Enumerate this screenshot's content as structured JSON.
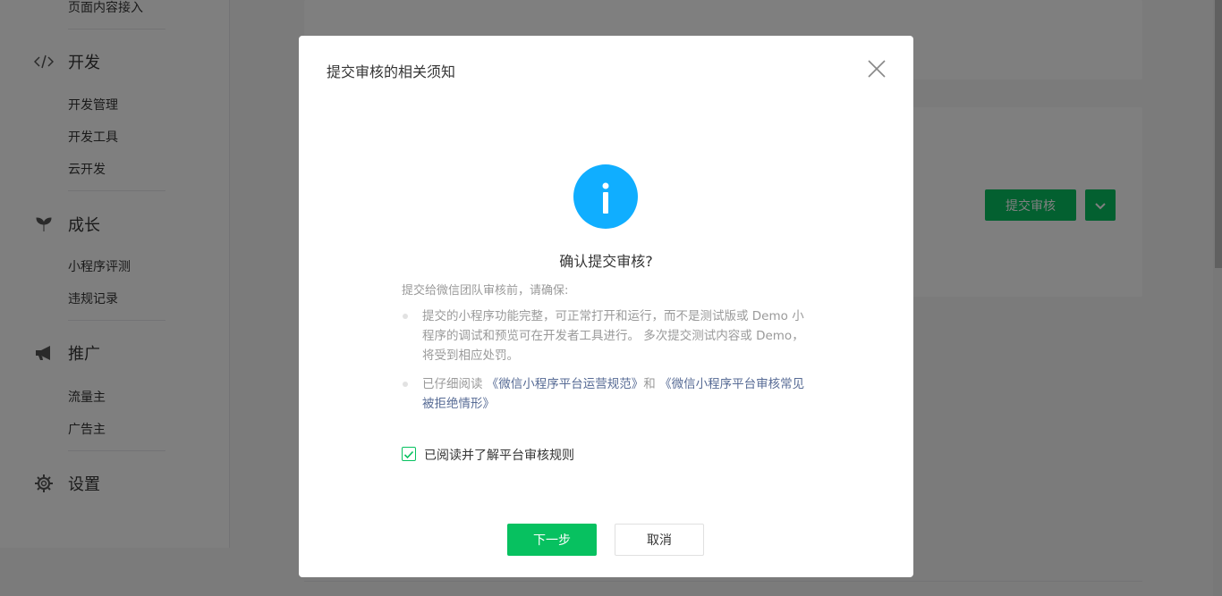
{
  "sidebar": {
    "top_item": "页面内容接入",
    "groups": [
      {
        "icon": "code-icon",
        "label": "开发",
        "items": [
          "开发管理",
          "开发工具",
          "云开发"
        ]
      },
      {
        "icon": "sprout-icon",
        "label": "成长",
        "items": [
          "小程序评测",
          "违规记录"
        ]
      },
      {
        "icon": "megaphone-icon",
        "label": "推广",
        "items": [
          "流量主",
          "广告主"
        ]
      },
      {
        "icon": "gear-icon",
        "label": "设置",
        "items": []
      }
    ]
  },
  "main": {
    "submit_button": "提交审核",
    "dropdown_icon": "chevron-down-icon"
  },
  "dialog": {
    "title": "提交审核的相关须知",
    "close_icon": "close-icon",
    "info_icon": "info-icon",
    "question": "确认提交审核?",
    "intro": "提交给微信团队审核前，请确保:",
    "bullet1": "提交的小程序功能完整，可正常打开和运行，而不是测试版或 Demo 小程序的调试和预览可在开发者工具进行。 多次提交测试内容或 Demo，将受到相应处罚。",
    "bullet2_prefix": "已仔细阅读 ",
    "bullet2_link1": "《微信小程序平台运营规范》",
    "bullet2_mid": "和 ",
    "bullet2_link2": "《微信小程序平台审核常见被拒绝情形》",
    "checkbox_label": "已阅读并了解平台审核规则",
    "checkbox_checked": true,
    "next_button": "下一步",
    "cancel_button": "取消"
  },
  "colors": {
    "brand_green": "#07c160",
    "info_blue": "#10aeff",
    "link": "#576b95"
  }
}
